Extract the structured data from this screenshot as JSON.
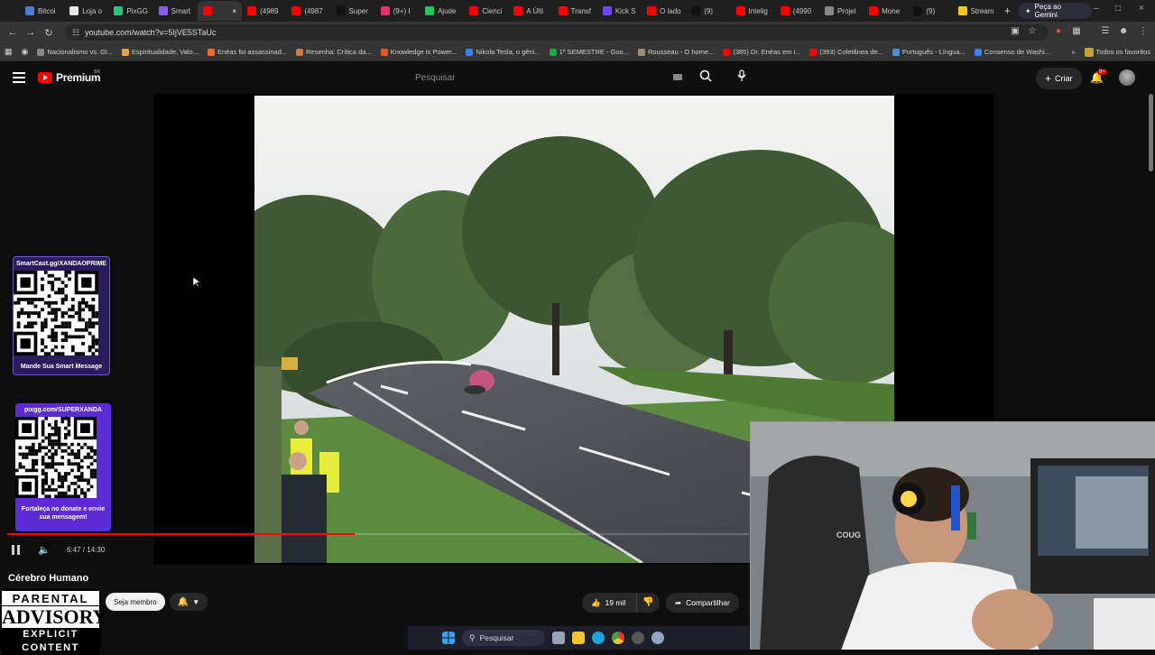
{
  "browser": {
    "tabs": [
      {
        "label": "Bitcoi",
        "color": "#4a7bd6"
      },
      {
        "label": "Loja o",
        "color": "#e8e8e8"
      },
      {
        "label": "PixGG",
        "color": "#2ec27e"
      },
      {
        "label": "Smart",
        "color": "#8a5cf6"
      },
      {
        "label": "",
        "color": "#ff0000",
        "active": true
      },
      {
        "label": "(4989",
        "color": "#ff0000"
      },
      {
        "label": "(4987",
        "color": "#ff0000"
      },
      {
        "label": "Super",
        "color": "#111111"
      },
      {
        "label": "(9+) I",
        "color": "#e1306c"
      },
      {
        "label": "Ajude",
        "color": "#22c55e"
      },
      {
        "label": "Cienci",
        "color": "#ff0000"
      },
      {
        "label": "A Últi",
        "color": "#ff0000"
      },
      {
        "label": "Transf",
        "color": "#ff0000"
      },
      {
        "label": "Kick S",
        "color": "#6b46ff"
      },
      {
        "label": "O lado",
        "color": "#ff0000"
      },
      {
        "label": "(9)",
        "color": "#111111"
      },
      {
        "label": "Intelig",
        "color": "#ff0000"
      },
      {
        "label": "(4990",
        "color": "#ff0000"
      },
      {
        "label": "Projet",
        "color": "#888888"
      },
      {
        "label": "Mone",
        "color": "#ff0000"
      },
      {
        "label": "(9)",
        "color": "#111111"
      },
      {
        "label": "Stream",
        "color": "#f5c518"
      }
    ],
    "new_tab_label": "+",
    "gemini_label": "Peça ao Gemini",
    "url": "youtube.com/watch?v=5IjVE5STaUc",
    "bookmarks": [
      "Nacionalismo vs. Gl...",
      "Espiritualidade, Valo...",
      "Enéas foi assassinad...",
      "Resenha: Crítica da...",
      "Knowledge is Power...",
      "Nikola Tesla, o gêni...",
      "1º SEMESTRE - Goo...",
      "Rousseau - O home...",
      "(385) Dr. Enéas em i...",
      "(393) Coletânea de...",
      "Português - Língua...",
      "Consenso de Washi..."
    ],
    "all_bookmarks_label": "Todos os favoritos"
  },
  "youtube": {
    "logo_text": "Premium",
    "logo_region": "BR",
    "search_placeholder": "Pesquisar",
    "create_label": "Criar",
    "notification_badge": "9+"
  },
  "overlays": {
    "qr1_title": "SmartCast.gg/XANDAOPRIME",
    "qr1_caption": "Mande Sua Smart Message",
    "qr2_title": "pixgg.com/SUPERXANDA",
    "qr2_caption": "Fortaleça no donate e envie sua mensagem!"
  },
  "player": {
    "current_time": "6:47",
    "duration": "14:30",
    "time_display": "6:47 / 14:30",
    "progress_fraction": 0.468
  },
  "video_info": {
    "channel_name": "Cérebro Humano",
    "member_label": "Seja membro",
    "likes": "19 mil",
    "share_label": "Compartilhar"
  },
  "advisory": {
    "line1": "PARENTAL",
    "line2": "ADVISORY",
    "line3": "EXPLICIT CONTENT"
  },
  "taskbar": {
    "search_label": "Pesquisar"
  }
}
